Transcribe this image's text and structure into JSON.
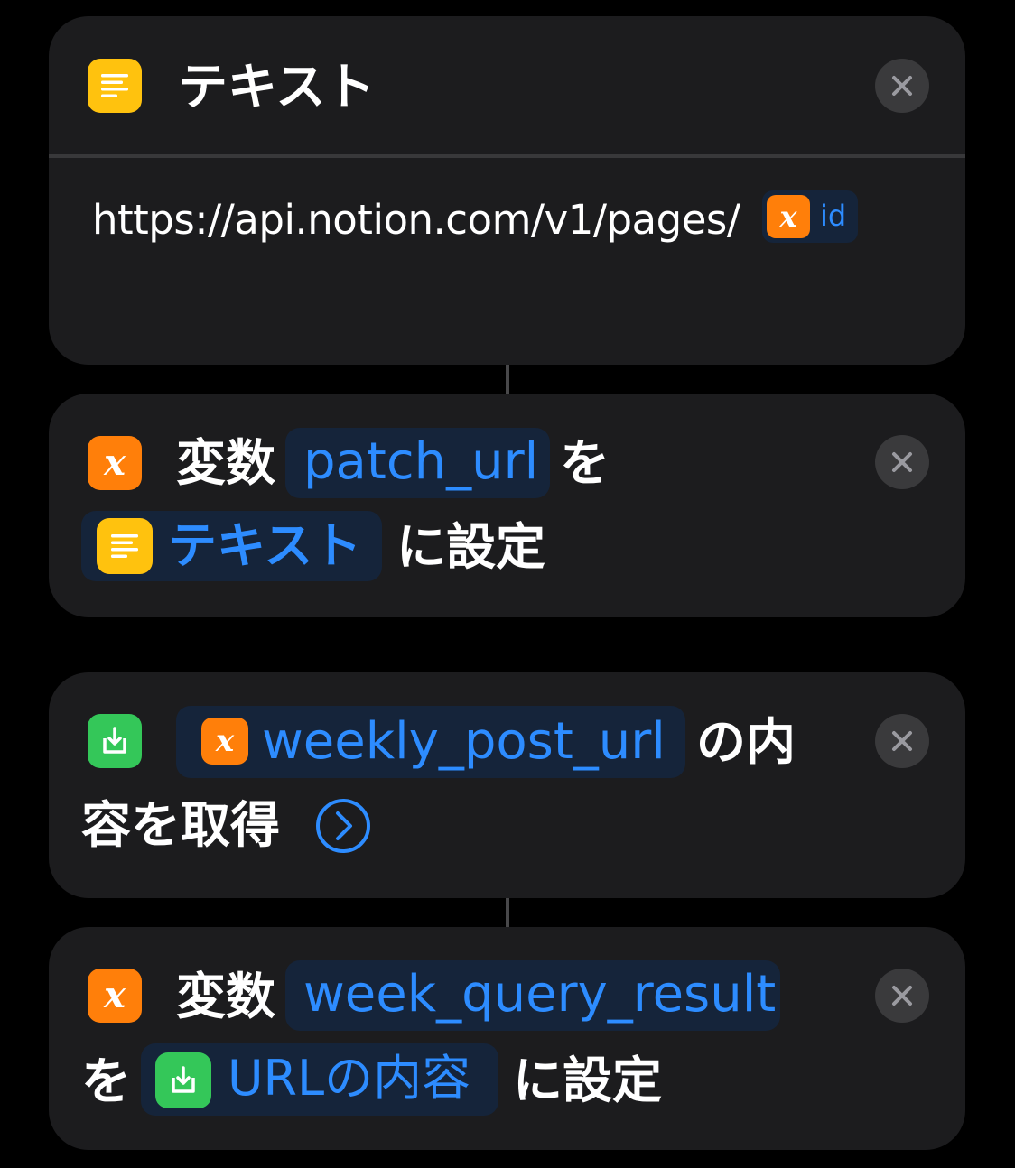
{
  "card1": {
    "title": "テキスト",
    "text_value": "https://api.notion.com/v1/pages/",
    "variable_token": "id"
  },
  "card2": {
    "prefix": "変数",
    "variable_name": "patch_url",
    "particle": "を",
    "value_token": "テキスト",
    "suffix": "に設定"
  },
  "card3": {
    "url_variable": "weekly_post_url",
    "suffix_line1": "の内",
    "suffix_line2": "容を取得"
  },
  "card4": {
    "prefix": "変数",
    "variable_name": "week_query_result",
    "particle": "を",
    "value_token": "URLの内容",
    "suffix": "に設定"
  },
  "colors": {
    "background": "#000000",
    "card": "#1c1c1e",
    "accent_blue": "#2d8cff",
    "text_icon_yellow": "#ffc20e",
    "variable_icon_orange": "#ff7f0a",
    "download_icon_green": "#34c759"
  },
  "icons": {
    "text_action": "text-lines-icon",
    "variable": "variable-x-icon",
    "get_contents": "download-tray-icon",
    "remove": "close-icon",
    "expand": "chevron-right-circle-icon"
  }
}
